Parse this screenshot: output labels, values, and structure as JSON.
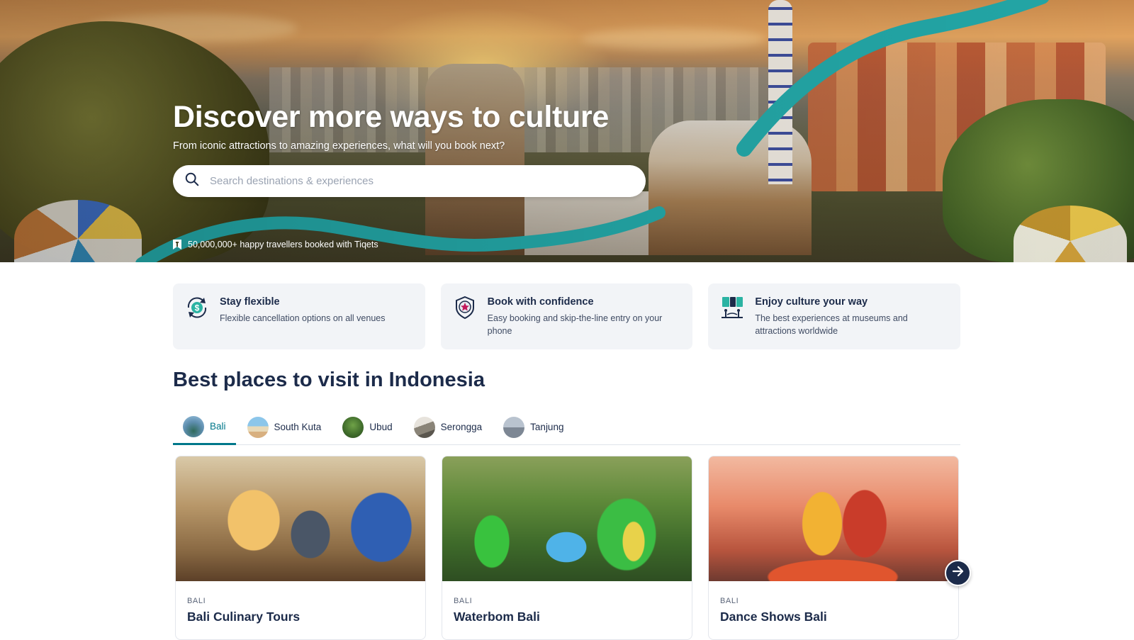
{
  "hero": {
    "title": "Discover more ways to culture",
    "subtitle": "From iconic attractions to amazing experiences, what will you book next?",
    "search_placeholder": "Search destinations & experiences",
    "trust_text": "50,000,000+ happy travellers booked with Tiqets",
    "accent_color": "#23a6a6"
  },
  "features": [
    {
      "icon": "dollar-refresh-icon",
      "title": "Stay flexible",
      "text": "Flexible cancellation options on all venues"
    },
    {
      "icon": "award-star-icon",
      "title": "Book with confidence",
      "text": "Easy booking and skip-the-line entry on your phone"
    },
    {
      "icon": "museum-visitors-icon",
      "title": "Enjoy culture your way",
      "text": "The best experiences at museums and attractions worldwide"
    }
  ],
  "places": {
    "title": "Best places to visit in Indonesia",
    "tabs": [
      {
        "label": "Bali",
        "active": true
      },
      {
        "label": "South Kuta",
        "active": false
      },
      {
        "label": "Ubud",
        "active": false
      },
      {
        "label": "Serongga",
        "active": false
      },
      {
        "label": "Tanjung",
        "active": false
      }
    ],
    "cards": [
      {
        "location": "BALI",
        "name": "Bali Culinary Tours"
      },
      {
        "location": "BALI",
        "name": "Waterbom Bali"
      },
      {
        "location": "BALI",
        "name": "Dance Shows Bali"
      }
    ],
    "active_color": "#00778a"
  }
}
